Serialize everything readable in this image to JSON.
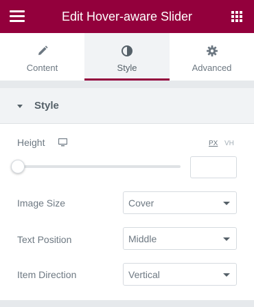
{
  "header": {
    "title": "Edit Hover-aware Slider",
    "menu_icon": "hamburger-menu-icon",
    "apps_icon": "grid-apps-icon",
    "background_color": "#93003c"
  },
  "tabs": [
    {
      "label": "Content",
      "icon": "pencil-icon",
      "active": false
    },
    {
      "label": "Style",
      "icon": "half-circle-contrast-icon",
      "active": true
    },
    {
      "label": "Advanced",
      "icon": "gear-icon",
      "active": false
    }
  ],
  "section": {
    "title": "Style",
    "expanded": true
  },
  "height_control": {
    "label": "Height",
    "device_icon": "desktop-monitor-icon",
    "units": [
      "PX",
      "VH"
    ],
    "selected_unit": "PX",
    "slider_level": 0,
    "value": ""
  },
  "image_size": {
    "label": "Image Size",
    "value": "Cover"
  },
  "text_position": {
    "label": "Text Position",
    "value": "Middle"
  },
  "item_direction": {
    "label": "Item Direction",
    "value": "Vertical"
  }
}
